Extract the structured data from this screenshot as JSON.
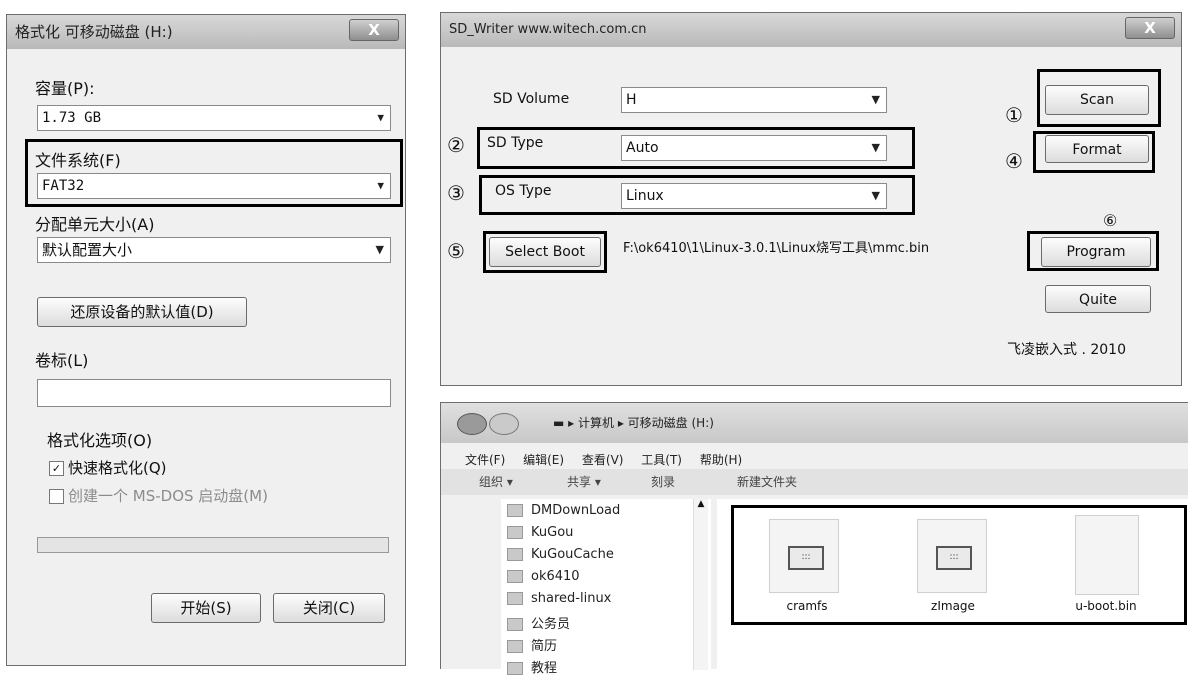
{
  "format_dialog": {
    "title": "格式化 可移动磁盘 (H:)",
    "close": "X",
    "capacity_label": "容量(P):",
    "capacity_value": "1.73 GB",
    "fs_label": "文件系统(F)",
    "fs_value": "FAT32",
    "alloc_label": "分配单元大小(A)",
    "alloc_value": "默认配置大小",
    "restore_button": "还原设备的默认值(D)",
    "volume_label": "卷标(L)",
    "volume_value": "",
    "options_label": "格式化选项(O)",
    "quick_format": "快速格式化(Q)",
    "msdos_boot": "创建一个 MS-DOS 启动盘(M)",
    "start_button": "开始(S)",
    "close_button": "关闭(C)"
  },
  "sd_writer": {
    "title": "SD_Writer   www.witech.com.cn",
    "close": "X",
    "sd_volume_label": "SD Volume",
    "sd_volume_value": "H",
    "sd_type_label": "SD Type",
    "sd_type_value": "Auto",
    "os_type_label": "OS Type",
    "os_type_value": "Linux",
    "select_boot_button": "Select Boot",
    "boot_path": "F:\\ok6410\\1\\Linux-3.0.1\\Linux烧写工具\\mmc.bin",
    "scan_button": "Scan",
    "format_button": "Format",
    "program_button": "Program",
    "quite_button": "Quite",
    "footer": "飞凌嵌入式 . 2010",
    "markers": [
      "①",
      "②",
      "③",
      "④",
      "⑤",
      "⑥"
    ]
  },
  "explorer": {
    "breadcrumb": [
      "计算机",
      "可移动磁盘 (H:)"
    ],
    "menu": [
      "文件(F)",
      "编辑(E)",
      "查看(V)",
      "工具(T)",
      "帮助(H)"
    ],
    "toolbar": [
      "组织 ▾",
      "共享 ▾",
      "刻录",
      "新建文件夹"
    ],
    "folders": [
      "DMDownLoad",
      "KuGou",
      "KuGouCache",
      "ok6410",
      "shared-linux",
      "公务员",
      "简历",
      "教程"
    ],
    "files": [
      "cramfs",
      "zImage",
      "u-boot.bin"
    ],
    "file_icon_text": ":::"
  }
}
